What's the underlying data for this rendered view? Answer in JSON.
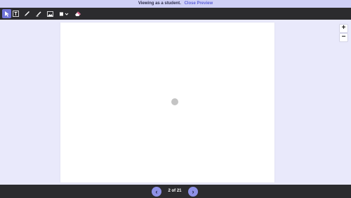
{
  "banner": {
    "message": "Viewing as a student.",
    "close_label": "Close Preview"
  },
  "toolbar": {
    "tools": [
      {
        "name": "select",
        "icon": "cursor-icon",
        "active": true
      },
      {
        "name": "text",
        "icon": "text-icon",
        "active": false
      },
      {
        "name": "pen",
        "icon": "pen-icon",
        "active": false
      },
      {
        "name": "highlighter",
        "icon": "highlighter-icon",
        "active": false
      },
      {
        "name": "image",
        "icon": "image-icon",
        "active": false
      },
      {
        "name": "shape",
        "icon": "shape-icon",
        "active": false
      },
      {
        "name": "eraser",
        "icon": "eraser-icon",
        "active": false
      }
    ]
  },
  "zoom": {
    "in_label": "+",
    "out_label": "−"
  },
  "pager": {
    "prev_label": "‹",
    "next_label": "›",
    "page_indicator": "2 of 21"
  },
  "colors": {
    "accent": "#6f73d8",
    "background": "#e9e9fb",
    "bar": "#2b2b2e"
  }
}
